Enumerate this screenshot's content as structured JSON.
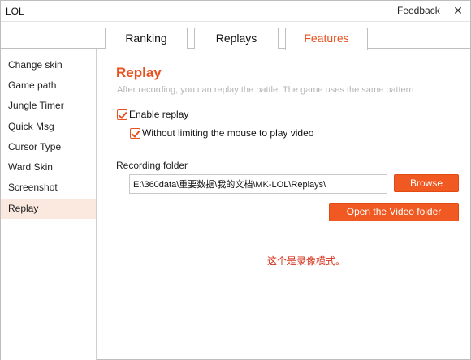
{
  "window": {
    "title": "LOL",
    "feedback_label": "Feedback",
    "close_glyph": "✕"
  },
  "tabs": [
    {
      "label": "Ranking",
      "active": false
    },
    {
      "label": "Replays",
      "active": false
    },
    {
      "label": "Features",
      "active": true
    }
  ],
  "sidebar": {
    "items": [
      {
        "label": "Change skin"
      },
      {
        "label": "Game path"
      },
      {
        "label": "Jungle Timer"
      },
      {
        "label": "Quick Msg"
      },
      {
        "label": "Cursor Type"
      },
      {
        "label": "Ward Skin"
      },
      {
        "label": "Screenshot"
      },
      {
        "label": "Replay",
        "active": true
      }
    ]
  },
  "replay": {
    "title": "Replay",
    "description": "After recording, you can replay the battle. The game uses the same pattern",
    "enable_replay_label": "Enable replay",
    "enable_replay_checked": true,
    "no_mouse_limit_label": "Without limiting the mouse to play video",
    "no_mouse_limit_checked": true,
    "recording_folder_label": "Recording folder",
    "recording_folder_value": "E:\\360data\\重要数据\\我的文档\\MK-LOL\\Replays\\",
    "browse_label": "Browse",
    "open_folder_label": "Open the Video folder",
    "note": "这个是录像模式。"
  },
  "colors": {
    "accent": "#e8501e",
    "button": "#f05a22",
    "active_item_bg": "#fbe9df",
    "note": "#d6321c"
  }
}
